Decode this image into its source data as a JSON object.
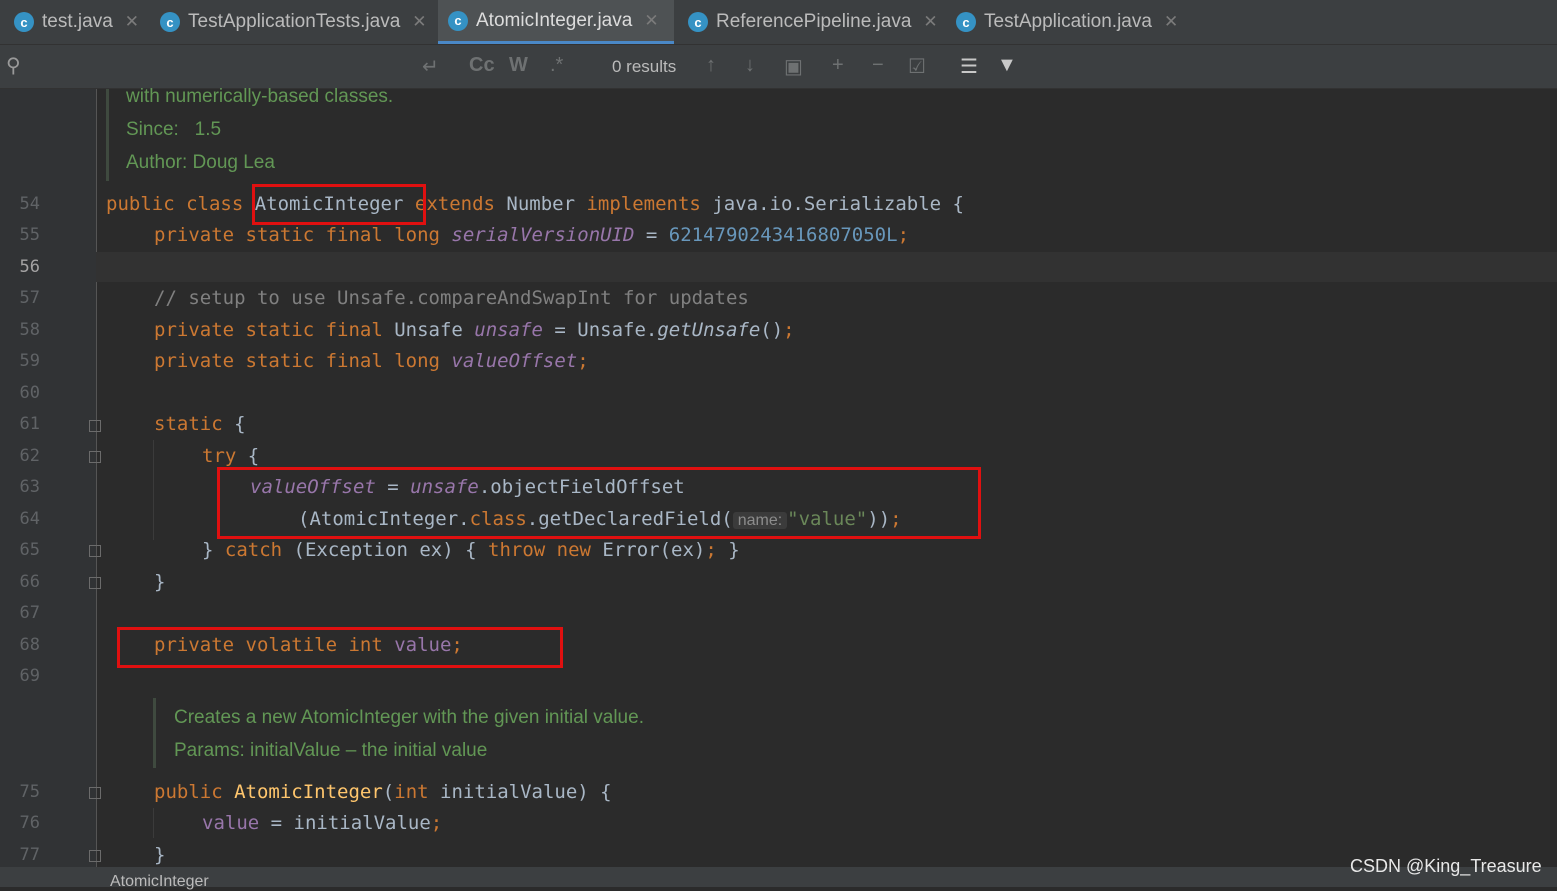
{
  "tabs": [
    {
      "label": "test.java",
      "icon": "c",
      "active": false
    },
    {
      "label": "TestApplicationTests.java",
      "icon": "c",
      "active": false
    },
    {
      "label": "AtomicInteger.java",
      "icon": "c",
      "active": true
    },
    {
      "label": "ReferencePipeline.java",
      "icon": "c",
      "active": false
    },
    {
      "label": "TestApplication.java",
      "icon": "c",
      "active": false
    }
  ],
  "search": {
    "results": "0 results",
    "match_case": "Cc",
    "words": "W",
    "regex": ".*"
  },
  "doc_top": {
    "line1": "with numerically-based classes.",
    "since": "Since:   1.5",
    "author": "Author: Doug Lea"
  },
  "doc_bottom": {
    "line1": "Creates a new AtomicInteger with the given initial value.",
    "line2": "Params: initialValue – the initial value"
  },
  "line_numbers": [
    "54",
    "55",
    "56",
    "57",
    "58",
    "59",
    "60",
    "61",
    "62",
    "63",
    "64",
    "65",
    "66",
    "67",
    "68",
    "69",
    "75",
    "76",
    "77"
  ],
  "current_line": "56",
  "code": {
    "l54": {
      "kw1": "public class ",
      "cls": "AtomicInteger",
      "kw2": " extends ",
      "t1": "Number",
      "kw3": " implements ",
      "t2": "java.io.Serializable {"
    },
    "l55": {
      "kw": "private static final long ",
      "f": "serialVersionUID",
      "eq": " = ",
      "n": "6214790243416807050L",
      "semi": ";"
    },
    "l57": {
      "c": "// setup to use Unsafe.compareAndSwapInt for updates"
    },
    "l58": {
      "kw": "private static final ",
      "t": "Unsafe ",
      "f": "unsafe",
      "eq": " = Unsafe.",
      "m": "getUnsafe",
      "end": "()",
      "semi": ";"
    },
    "l59": {
      "kw": "private static final long ",
      "f": "valueOffset",
      "semi": ";"
    },
    "l61": {
      "kw": "static ",
      "p": "{"
    },
    "l62": {
      "kw": "try ",
      "p": "{"
    },
    "l63": {
      "f1": "valueOffset",
      "eq": " = ",
      "f2": "unsafe",
      "rest": ".objectFieldOffset"
    },
    "l64": {
      "a": "(AtomicInteger.",
      "kw": "class",
      "b": ".getDeclaredField(",
      "hint": "name:",
      "s": "\"value\"",
      "c": "))",
      "semi": ";"
    },
    "l65": {
      "a": "} ",
      "kw1": "catch ",
      "b": "(Exception ex) { ",
      "kw2": "throw new ",
      "c": "Error(ex)",
      "semi": ";",
      "d": " }"
    },
    "l66": {
      "p": "}"
    },
    "l68": {
      "kw": "private volatile int ",
      "f": "value",
      "semi": ";"
    },
    "l75": {
      "kw": "public ",
      "fn": "AtomicInteger",
      "a": "(",
      "kw2": "int ",
      "b": "initialValue) {"
    },
    "l76": {
      "f": "value",
      "eq": " = initialValue",
      "semi": ";"
    },
    "l77": {
      "p": "}"
    }
  },
  "breadcrumb": "AtomicInteger",
  "watermark": "CSDN @King_Treasure",
  "colors": {
    "keyword": "#cc7832",
    "field": "#9876aa",
    "number": "#6897bb",
    "string": "#6a8759",
    "doc": "#629755",
    "highlight": "#e01010"
  }
}
